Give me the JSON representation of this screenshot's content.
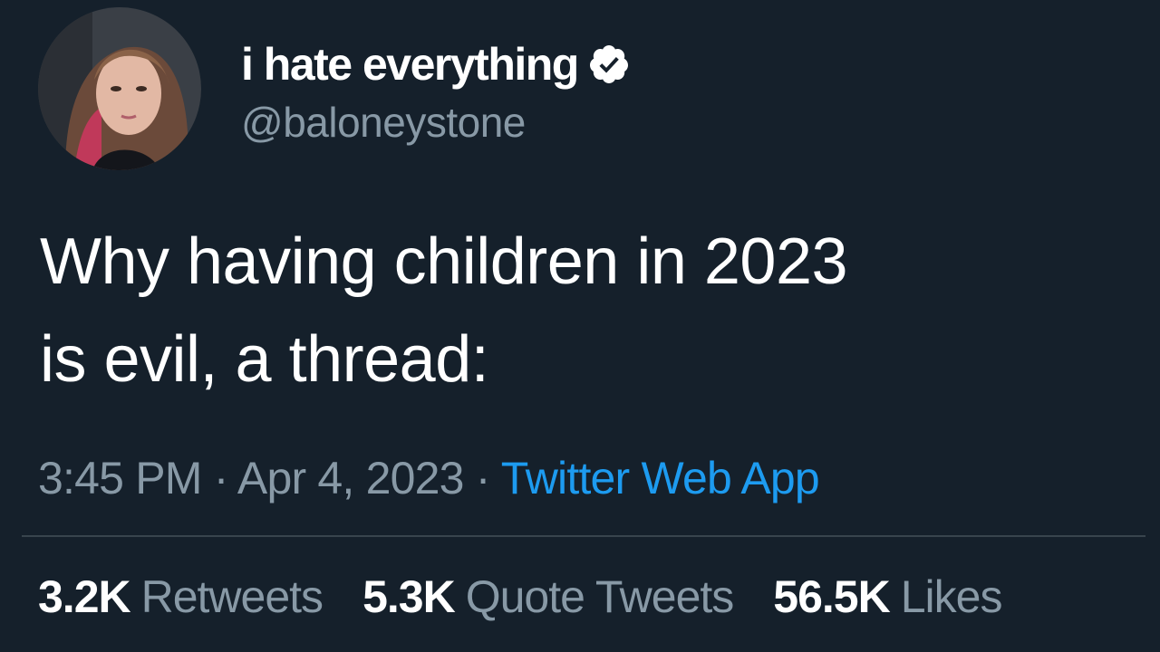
{
  "user": {
    "display_name": "i hate everything",
    "handle": "@baloneystone",
    "verified_icon": "verified-badge-icon"
  },
  "tweet": {
    "line1": "Why having children in 2023",
    "line2": "is evil, a thread:"
  },
  "meta": {
    "time": "3:45 PM",
    "separator": "·",
    "date": "Apr 4, 2023",
    "source": "Twitter Web App"
  },
  "stats": {
    "retweets_count": "3.2K",
    "retweets_label": "Retweets",
    "quotes_count": "5.3K",
    "quotes_label": "Quote Tweets",
    "likes_count": "56.5K",
    "likes_label": "Likes"
  },
  "colors": {
    "background": "#15202b",
    "text_primary": "#ffffff",
    "text_secondary": "#8899a6",
    "link": "#1d9bf0"
  }
}
